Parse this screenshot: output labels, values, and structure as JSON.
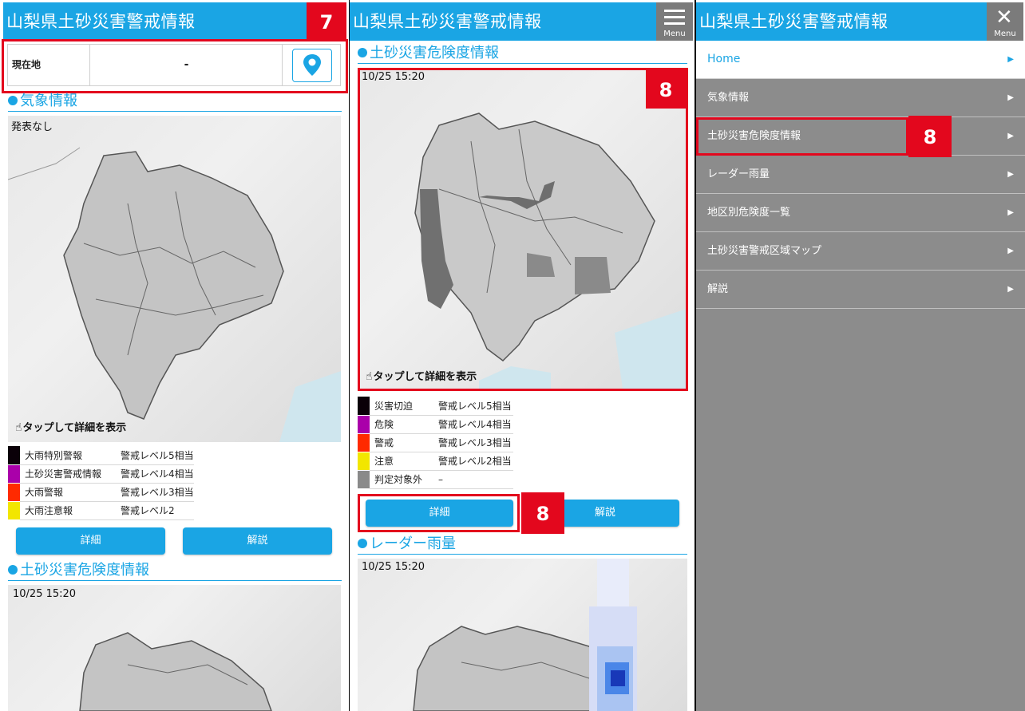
{
  "app_title": "山梨県土砂災害警戒情報",
  "menu_label": "Menu",
  "callouts": {
    "seven": "7",
    "eight": "8"
  },
  "panel1": {
    "location": {
      "label": "現在地",
      "value": "-",
      "pin_icon": "map-pin-icon"
    },
    "weather_section": "気象情報",
    "weather_map_status": "発表なし",
    "tap_note": "タップして詳細を表示",
    "legend": [
      {
        "color": "#0a0008",
        "name": "大雨特別警報",
        "level": "警戒レベル5相当"
      },
      {
        "color": "#aa00aa",
        "name": "土砂災害警戒情報",
        "level": "警戒レベル4相当"
      },
      {
        "color": "#ff2a00",
        "name": "大雨警報",
        "level": "警戒レベル3相当"
      },
      {
        "color": "#f2e600",
        "name": "大雨注意報",
        "level": "警戒レベル2"
      }
    ],
    "detail_button": "詳細",
    "explain_button": "解説",
    "risk_section": "土砂災害危険度情報",
    "risk_timestamp": "10/25 15:20"
  },
  "panel2": {
    "risk_section": "土砂災害危険度情報",
    "risk_timestamp": "10/25 15:20",
    "tap_note": "タップして詳細を表示",
    "legend": [
      {
        "color": "#0a0008",
        "name": "災害切迫",
        "level": "警戒レベル5相当"
      },
      {
        "color": "#aa00aa",
        "name": "危険",
        "level": "警戒レベル4相当"
      },
      {
        "color": "#ff2a00",
        "name": "警戒",
        "level": "警戒レベル3相当"
      },
      {
        "color": "#f2e600",
        "name": "注意",
        "level": "警戒レベル2相当"
      },
      {
        "color": "#8a8a8a",
        "name": "判定対象外",
        "level": "–"
      }
    ],
    "detail_button": "詳細",
    "explain_button": "解説",
    "radar_section": "レーダー雨量",
    "radar_timestamp": "10/25 15:20"
  },
  "nav_menu": {
    "items": [
      {
        "label": "Home"
      },
      {
        "label": "気象情報"
      },
      {
        "label": "土砂災害危険度情報"
      },
      {
        "label": "レーダー雨量"
      },
      {
        "label": "地区別危険度一覧"
      },
      {
        "label": "土砂災害警戒区域マップ"
      },
      {
        "label": "解説"
      }
    ]
  },
  "colors": {
    "accent": "#1aa5e4",
    "callout": "#e3071d",
    "nav_bg": "#8c8c8c",
    "menu_button": "#7b7b7b"
  }
}
